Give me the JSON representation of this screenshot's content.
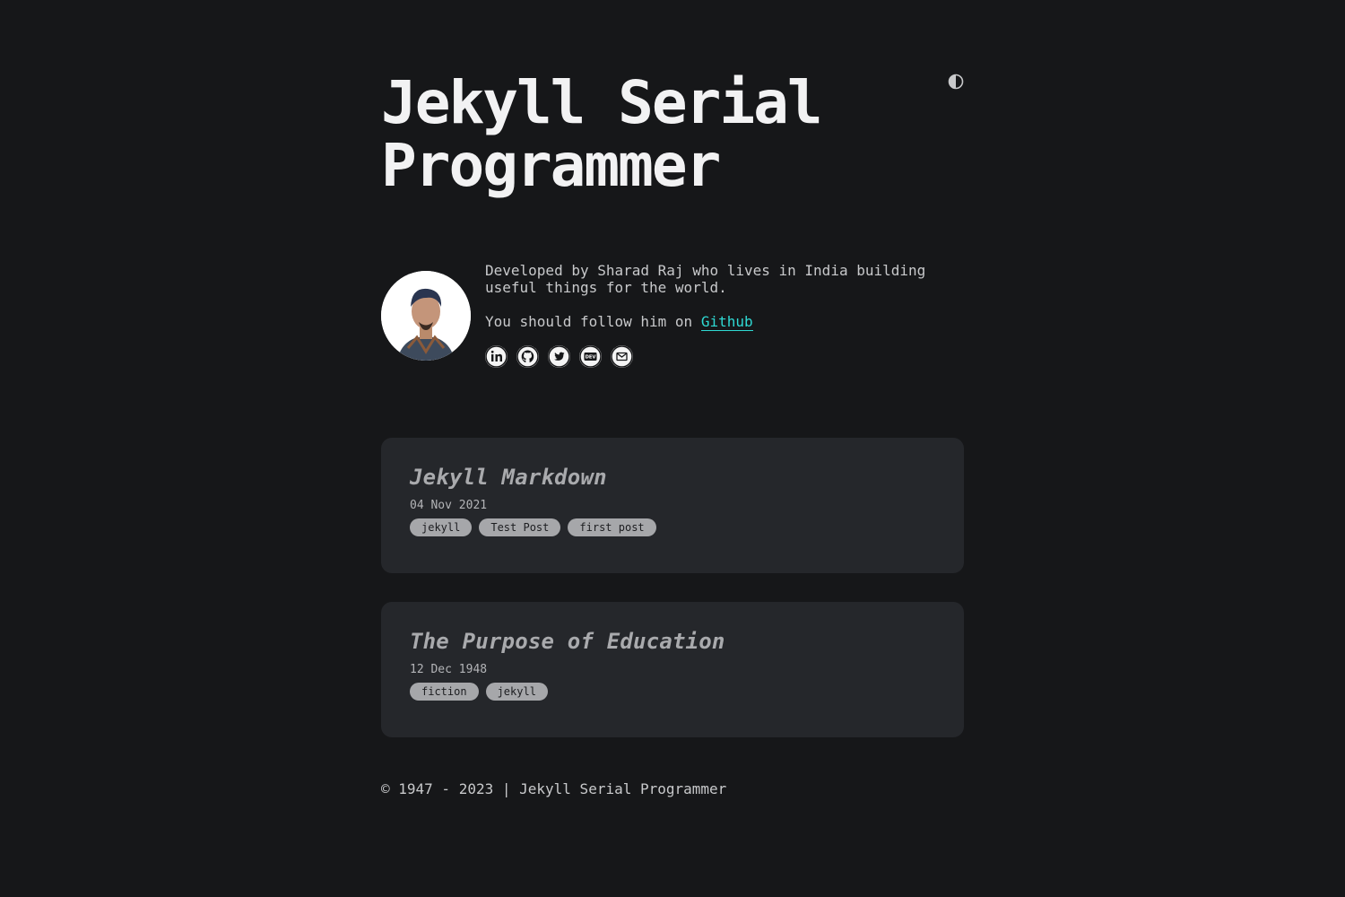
{
  "header": {
    "title": "Jekyll Serial Programmer",
    "theme_toggle_icon": "half-circle-icon"
  },
  "intro": {
    "bio": "Developed by Sharad Raj who lives in India building useful things for the world.",
    "follow_prefix": "You should follow him on ",
    "follow_link": "Github",
    "socials": [
      {
        "icon": "linkedin-icon"
      },
      {
        "icon": "github-icon"
      },
      {
        "icon": "twitter-icon"
      },
      {
        "icon": "dev-icon",
        "label": "DEV"
      },
      {
        "icon": "mail-icon"
      }
    ]
  },
  "posts": [
    {
      "title": "Jekyll Markdown",
      "date": "04 Nov 2021",
      "tags": [
        "jekyll",
        "Test Post",
        "first post"
      ]
    },
    {
      "title": "The Purpose of Education",
      "date": "12 Dec 1948",
      "tags": [
        "fiction",
        "jekyll"
      ]
    }
  ],
  "footer": {
    "text": "© 1947 - 2023 | Jekyll Serial Programmer"
  },
  "colors": {
    "background": "#161719",
    "card": "#25272b",
    "accent": "#2fd9d3",
    "tag_bg": "#a6a7aa"
  }
}
